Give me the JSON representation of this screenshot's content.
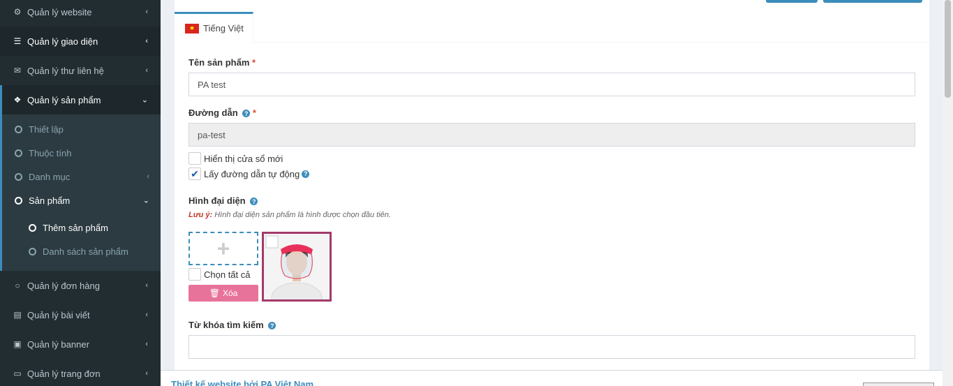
{
  "sidebar": {
    "items": [
      {
        "label": "Quản lý website",
        "icon": "gears-icon"
      },
      {
        "label": "Quản lý giao diện",
        "icon": "bars-icon"
      },
      {
        "label": "Quản lý thư liên hệ",
        "icon": "envelope-icon"
      },
      {
        "label": "Quản lý sản phẩm",
        "icon": "cubes-icon"
      },
      {
        "label": "Quản lý đơn hàng",
        "icon": "circle-icon"
      },
      {
        "label": "Quản lý bài viết",
        "icon": "newspaper-icon"
      },
      {
        "label": "Quản lý banner",
        "icon": "image-icon"
      },
      {
        "label": "Quản lý trang đơn",
        "icon": "laptop-icon"
      }
    ],
    "submenu": [
      {
        "label": "Thiết lập"
      },
      {
        "label": "Thuộc tính"
      },
      {
        "label": "Danh mục"
      },
      {
        "label": "Sản phẩm"
      }
    ],
    "submenu2": [
      {
        "label": "Thêm sản phẩm"
      },
      {
        "label": "Danh sách sản phẩm"
      }
    ]
  },
  "tabs": [
    {
      "label": "Tiếng Việt"
    }
  ],
  "form": {
    "name_label": "Tên sản phẩm",
    "required_mark": "*",
    "name_value": "PA test",
    "slug_label": "Đường dẫn",
    "slug_value": "pa-test",
    "new_window_label": "Hiển thị cửa sổ mới",
    "auto_slug_label": "Lấy đường dẫn tự động",
    "auto_slug_checked": true,
    "avatar_label": "Hình đại diện",
    "note_prefix": "Lưu ý:",
    "note_text": "Hình đại diện sản phẩm là hình được chọn đầu tiên.",
    "select_all_label": "Chọn tất cả",
    "delete_label": "Xóa",
    "keywords_label": "Từ khóa tìm kiếm",
    "keywords_value": ""
  },
  "footer": {
    "link": "Thiết kế website bởi PA Việt Nam"
  },
  "colors": {
    "accent": "#3c8dbc",
    "sidebar_bg": "#222d32",
    "delete": "#e8739a"
  }
}
